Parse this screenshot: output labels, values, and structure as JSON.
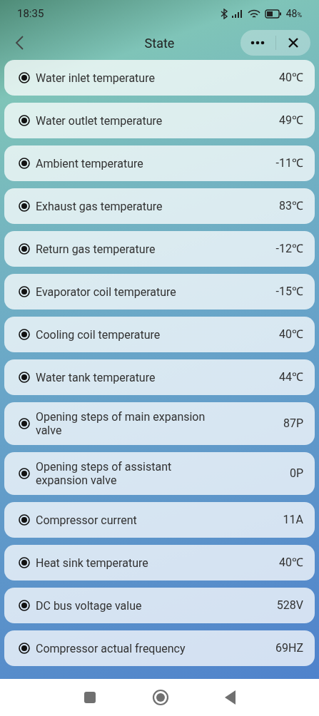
{
  "status_bar": {
    "time": "18:35",
    "battery": "48",
    "battery_unit": "%"
  },
  "header": {
    "title": "State"
  },
  "items": [
    {
      "label": "Water inlet temperature",
      "value": "40℃"
    },
    {
      "label": "Water outlet temperature",
      "value": "49℃"
    },
    {
      "label": "Ambient temperature",
      "value": "-11℃"
    },
    {
      "label": "Exhaust gas temperature",
      "value": "83℃"
    },
    {
      "label": "Return gas temperature",
      "value": "-12℃"
    },
    {
      "label": "Evaporator coil temperature",
      "value": "-15℃"
    },
    {
      "label": "Cooling coil temperature",
      "value": "40℃"
    },
    {
      "label": "Water tank temperature",
      "value": "44℃"
    },
    {
      "label": "Opening steps of main expansion valve",
      "value": "87P"
    },
    {
      "label": "Opening steps of assistant expansion valve",
      "value": "0P"
    },
    {
      "label": "Compressor current",
      "value": "11A"
    },
    {
      "label": "Heat sink temperature",
      "value": "40℃"
    },
    {
      "label": "DC bus voltage value",
      "value": "528V"
    },
    {
      "label": "Compressor actual frequency",
      "value": "69HZ"
    }
  ]
}
